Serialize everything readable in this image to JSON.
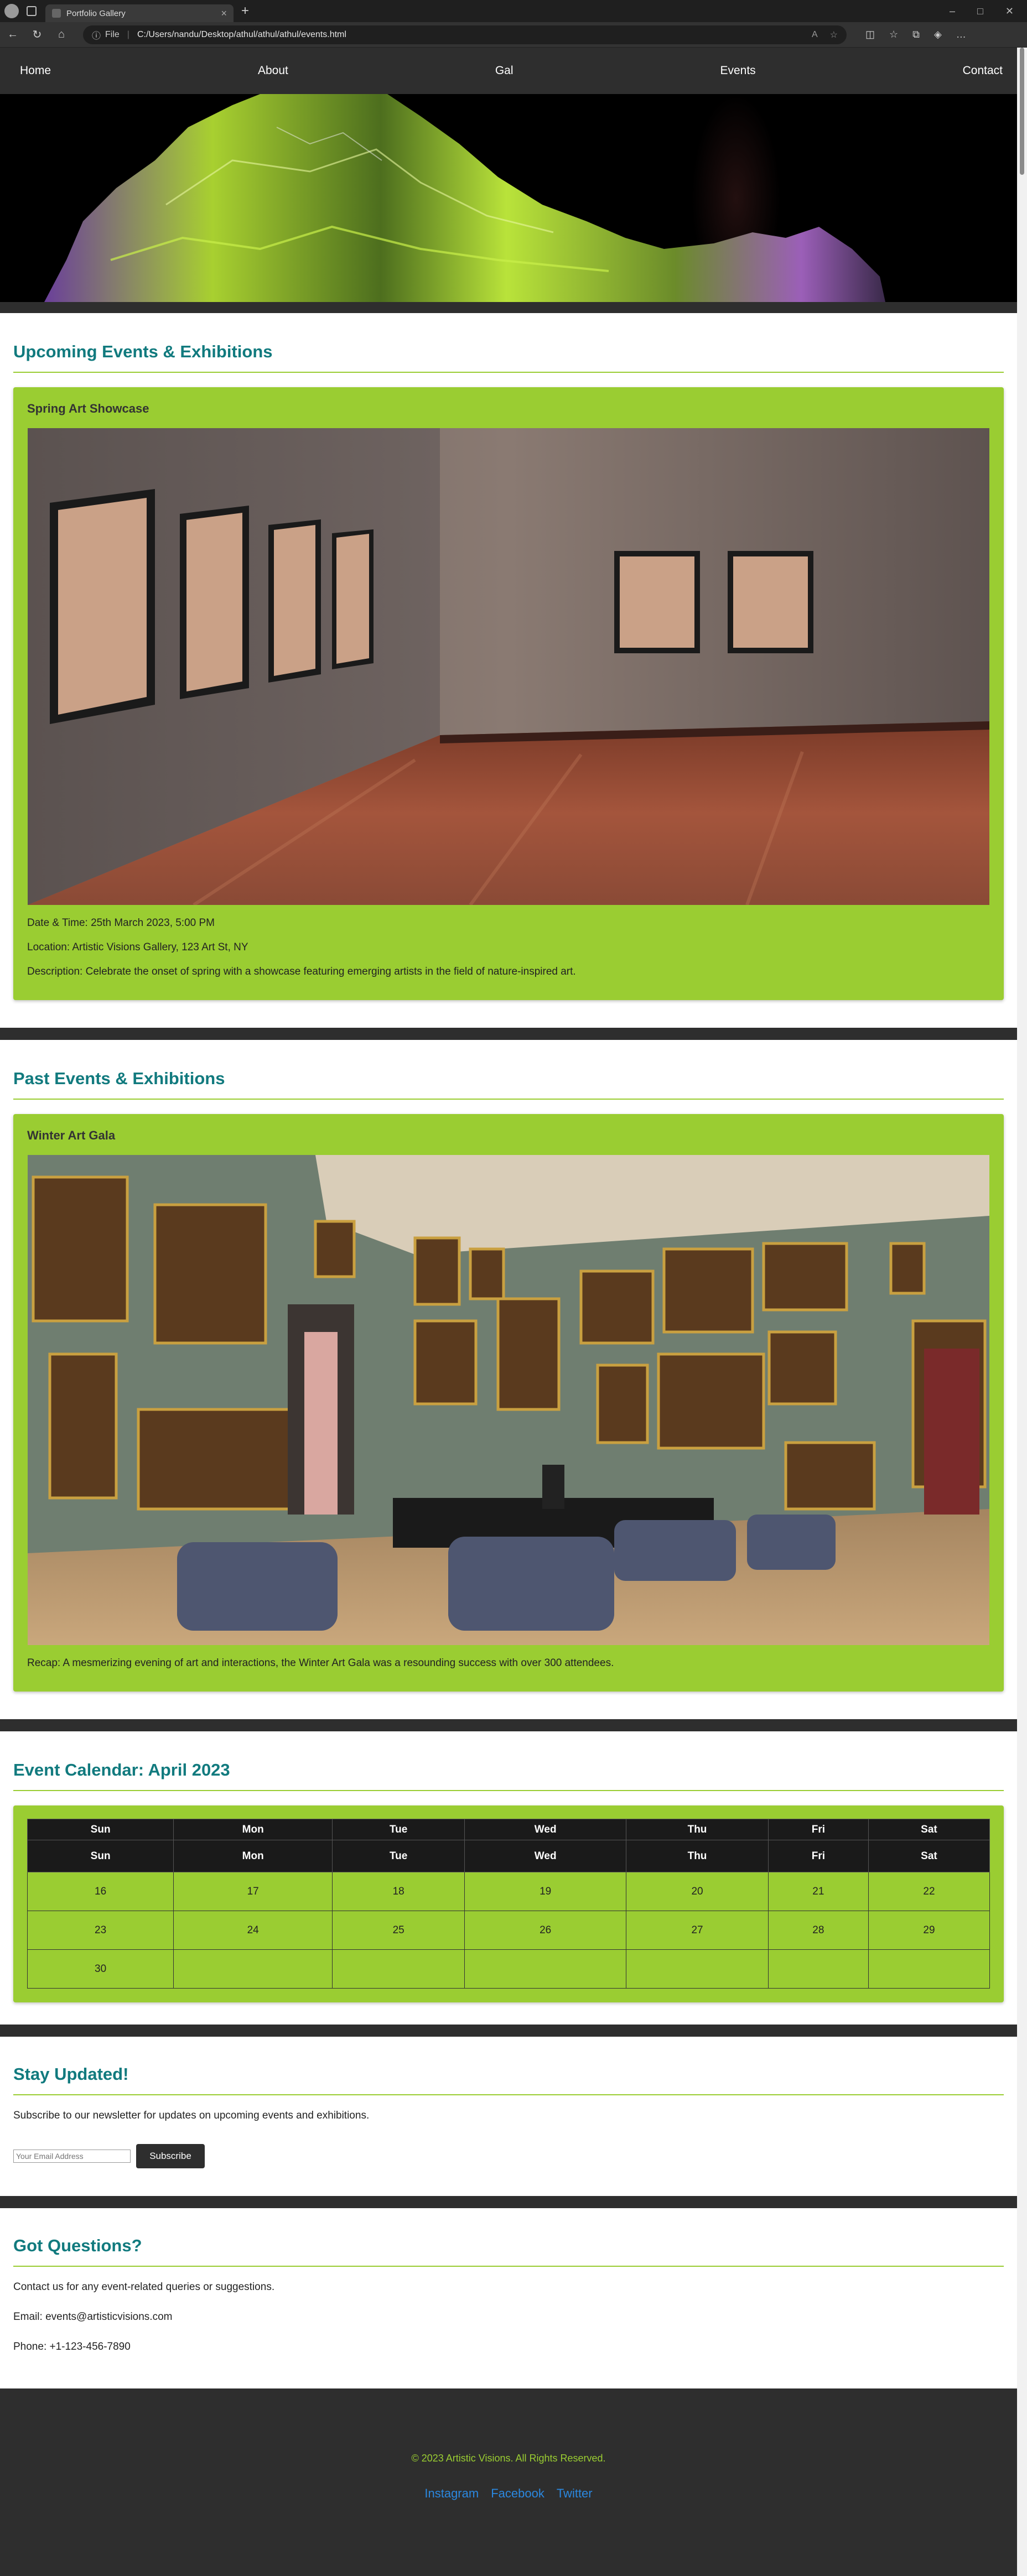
{
  "browser": {
    "tab_title": "Portfolio Gallery",
    "url_scheme": "File",
    "url": "C:/Users/nandu/Desktop/athul/athul/athul/events.html"
  },
  "nav": {
    "items": [
      "Home",
      "About",
      "Gal",
      "Events",
      "Contact"
    ]
  },
  "upcoming": {
    "heading": "Upcoming Events & Exhibitions",
    "event_title": "Spring Art Showcase",
    "datetime": "Date & Time: 25th March 2023, 5:00 PM",
    "location": "Location: Artistic Visions Gallery, 123 Art St, NY",
    "description": "Description: Celebrate the onset of spring with a showcase featuring emerging artists in the field of nature-inspired art."
  },
  "past": {
    "heading": "Past Events & Exhibitions",
    "event_title": "Winter Art Gala",
    "recap": "Recap: A mesmerizing evening of art and interactions, the Winter Art Gala was a resounding success with over 300 attendees."
  },
  "calendar": {
    "heading": "Event Calendar: April 2023",
    "days": [
      "Sun",
      "Mon",
      "Tue",
      "Wed",
      "Thu",
      "Fri",
      "Sat"
    ],
    "weeks": [
      [
        "16",
        "17",
        "18",
        "19",
        "20",
        "21",
        "22"
      ],
      [
        "23",
        "24",
        "25",
        "26",
        "27",
        "28",
        "29"
      ],
      [
        "30",
        "",
        "",
        "",
        "",
        "",
        ""
      ]
    ]
  },
  "newsletter": {
    "heading": "Stay Updated!",
    "text": "Subscribe to our newsletter for updates on upcoming events and exhibitions.",
    "placeholder": "Your Email Address",
    "button": "Subscribe"
  },
  "contact": {
    "heading": "Got Questions?",
    "text": "Contact us for any event-related queries or suggestions.",
    "email": "Email: events@artisticvisions.com",
    "phone": "Phone: +1-123-456-7890"
  },
  "footer": {
    "copyright": "© 2023 Artistic Visions. All Rights Reserved.",
    "links": [
      "Instagram",
      "Facebook",
      "Twitter"
    ]
  },
  "colors": {
    "accent": "#9acd32",
    "heading": "#117a7e",
    "dark": "#2e2e2e",
    "link": "#2b88e0"
  }
}
